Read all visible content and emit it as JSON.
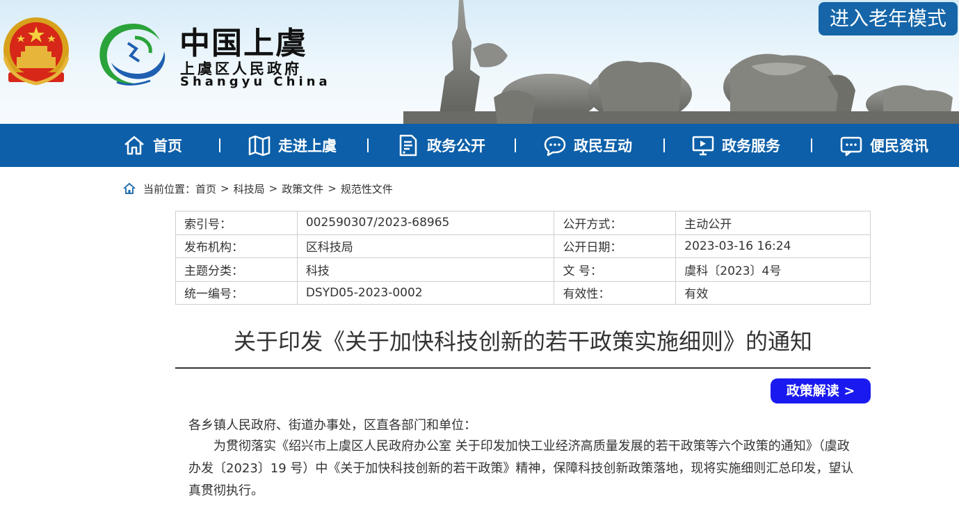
{
  "header": {
    "logo_title": "中国上虞",
    "logo_subtitle": "上虞区人民政府",
    "logo_english": "Shangyu  China",
    "elder_mode_label": "进入老年模式"
  },
  "nav": {
    "items": [
      {
        "label": "首页",
        "icon": "home-icon"
      },
      {
        "label": "走进上虞",
        "icon": "map-icon"
      },
      {
        "label": "政务公开",
        "icon": "document-icon"
      },
      {
        "label": "政民互动",
        "icon": "chat-icon"
      },
      {
        "label": "政务服务",
        "icon": "monitor-icon"
      },
      {
        "label": "便民资讯",
        "icon": "message-icon"
      }
    ],
    "colors": {
      "bar": "#0c5fa8"
    }
  },
  "breadcrumb": {
    "prefix": "当前位置：",
    "items": [
      "首页",
      "科技局",
      "政策文件",
      "规范性文件"
    ],
    "separator": ">"
  },
  "meta": {
    "rows": [
      {
        "k1": "索引号：",
        "v1": "002590307/2023-68965",
        "k2": "公开方式：",
        "v2": "主动公开"
      },
      {
        "k1": "发布机构：",
        "v1": "区科技局",
        "k2": "公开日期：",
        "v2": "2023-03-16 16:24"
      },
      {
        "k1": "主题分类：",
        "v1": "科技",
        "k2": "文 号：",
        "v2": "虞科〔2023〕4号"
      },
      {
        "k1": "统一编号：",
        "v1": "DSYD05-2023-0002",
        "k2": "有效性：",
        "v2": "有效"
      }
    ]
  },
  "document": {
    "title": "关于印发《关于加快科技创新的若干政策实施细则》的通知",
    "policy_button": "政策解读 >",
    "salutation": "各乡镇人民政府、街道办事处，区直各部门和单位：",
    "paragraph": "为贯彻落实《绍兴市上虞区人民政府办公室 关于印发加快工业经济高质量发展的若干政策等六个政策的通知》（虞政办发〔2023〕19 号）中《关于加快科技创新的若干政策》精神，保障科技创新政策落地，现将实施细则汇总印发，望认真贯彻执行。"
  }
}
